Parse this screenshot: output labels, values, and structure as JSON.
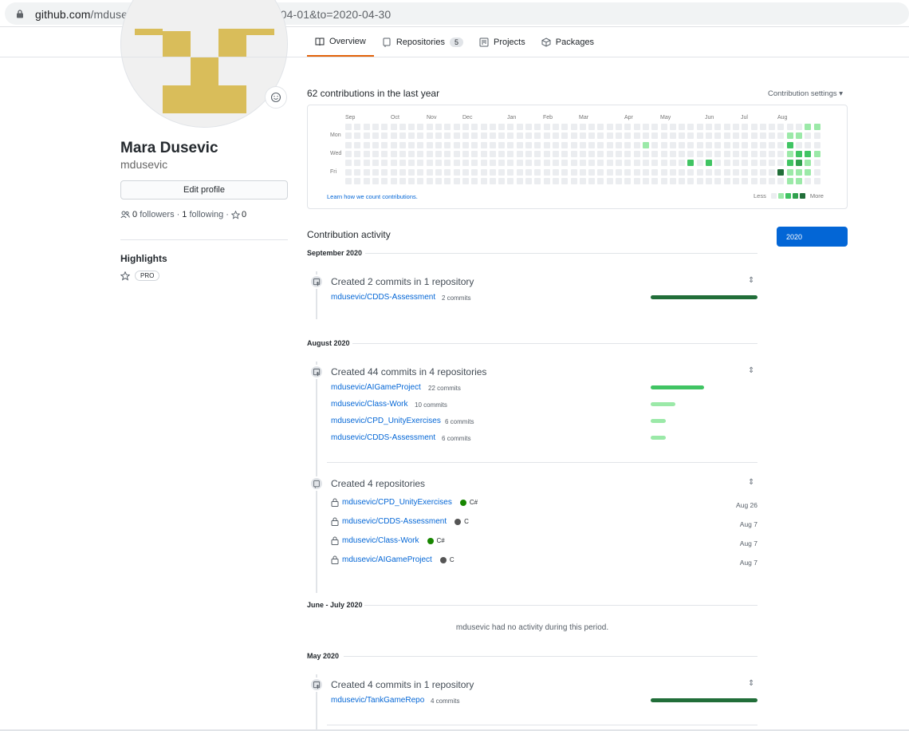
{
  "browser": {
    "url_host": "github.com",
    "url_rest": "/mdusevic?tab=overview&from=2020-04-01&to=2020-04-30"
  },
  "tabs": [
    {
      "label": "Overview",
      "icon": "book-icon",
      "selected": true
    },
    {
      "label": "Repositories",
      "icon": "repo-icon",
      "count": "5"
    },
    {
      "label": "Projects",
      "icon": "project-icon"
    },
    {
      "label": "Packages",
      "icon": "package-icon"
    }
  ],
  "profile": {
    "name": "Mara Dusevic",
    "login": "mdusevic",
    "edit_label": "Edit profile",
    "followers": "0",
    "followers_label": "followers",
    "following": "1",
    "following_label": "following",
    "stars": "0",
    "highlights_label": "Highlights",
    "pro_label": "PRO",
    "avatar_color": "#d9bd5a"
  },
  "contributions": {
    "title": "62 contributions in the last year",
    "settings_label": "Contribution settings",
    "months": [
      "Sep",
      "Oct",
      "Nov",
      "Dec",
      "Jan",
      "Feb",
      "Mar",
      "Apr",
      "May",
      "Jun",
      "Jul",
      "Aug"
    ],
    "days": [
      "Mon",
      "Wed",
      "Fri"
    ],
    "learn_label": "Learn how we count contributions.",
    "less_label": "Less",
    "more_label": "More",
    "colors": [
      "#ebedf0",
      "#9be9a8",
      "#40c463",
      "#30a14e",
      "#216e39"
    ]
  },
  "activity": {
    "title": "Contribution activity",
    "year_button": "2020",
    "periods": [
      {
        "label": "September 2020",
        "events": [
          {
            "title": "Created 2 commits in 1 repository",
            "repos": [
              {
                "name": "mdusevic/CDDS-Assessment",
                "count": "2 commits",
                "share": 1.0
              }
            ]
          }
        ]
      },
      {
        "label": "August 2020",
        "events": [
          {
            "title": "Created 44 commits in 4 repositories",
            "repos": [
              {
                "name": "mdusevic/AIGameProject",
                "count": "22 commits",
                "share": 0.5
              },
              {
                "name": "mdusevic/Class-Work",
                "count": "10 commits",
                "share": 0.23
              },
              {
                "name": "mdusevic/CPD_UnityExercises",
                "count": "6 commits",
                "share": 0.14
              },
              {
                "name": "mdusevic/CDDS-Assessment",
                "count": "6 commits",
                "share": 0.14
              }
            ]
          },
          {
            "title": "Created 4 repositories",
            "created": [
              {
                "name": "mdusevic/CPD_UnityExercises",
                "lang": "C#",
                "lang_color": "#178600",
                "date": "Aug 26"
              },
              {
                "name": "mdusevic/CDDS-Assessment",
                "lang": "C",
                "lang_color": "#555555",
                "date": "Aug 7"
              },
              {
                "name": "mdusevic/Class-Work",
                "lang": "C#",
                "lang_color": "#178600",
                "date": "Aug 7"
              },
              {
                "name": "mdusevic/AIGameProject",
                "lang": "C",
                "lang_color": "#555555",
                "date": "Aug 7"
              }
            ]
          }
        ]
      },
      {
        "label": "June - July 2020",
        "no_activity": "mdusevic had no activity during this period."
      },
      {
        "label": "May 2020",
        "events": [
          {
            "title": "Created 4 commits in 1 repository",
            "repos": [
              {
                "name": "mdusevic/TankGameRepo",
                "count": "4 commits",
                "share": 1.0
              }
            ]
          }
        ]
      }
    ]
  }
}
